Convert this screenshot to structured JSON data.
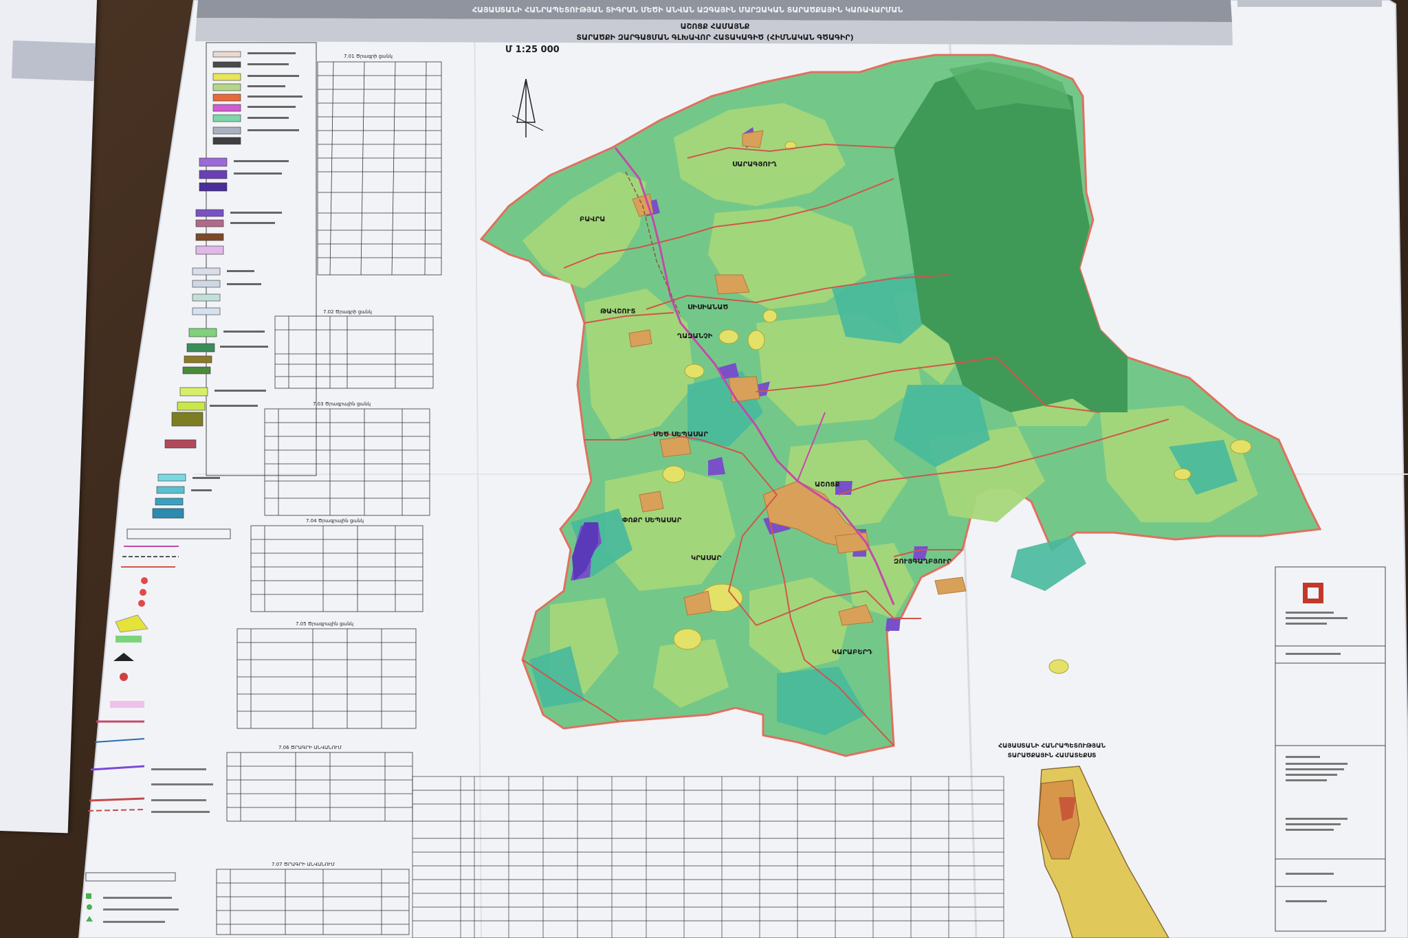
{
  "document": {
    "header_top": "ՀԱՅԱՍՏԱՆԻ ՀԱՆՐԱՊԵՏՈՒԹՅԱՆ ՏԻԳՐԱՆ ՄԵԾԻ ԱՆՎԱՆ ԱԶԳԱՅԻՆ ՄԱՐԶԱԿԱՆ ՏԱՐԱԾՔԱՅԻՆ ԿԱՌԱՎԱՐՄԱՆ",
    "community_title": "ԱՇՈՑՔ ՀԱՄԱՅՆՔ",
    "plan_title": "ՏԱՐԱԾՔԻ ԶԱՐԳԱՑՄԱՆ ԳԼԽԱՎՈՐ ՀԱՏԱԿԱԳԻԾ (ՀԻՄՆԱԿԱՆ ԳԾԱԳԻՐ)",
    "scale": "Մ 1:25 000",
    "inset_title_1": "ՀԱՅԱՍՏԱՆԻ ՀԱՆՐԱՊԵՏՈՒԹՅԱՆ",
    "inset_title_2": "ՏԱՐԱԾՔԱՅԻՆ ՀԱՄԱՏԵՔՍՏ"
  },
  "map": {
    "settlements": [
      {
        "id": "marmashen",
        "name": "ՍԱՐԱԳՅՈՒՂ"
      },
      {
        "id": "bavra",
        "name": "ԲԱՎՐԱ"
      },
      {
        "id": "tavshut",
        "name": "ԹԱՎՇՈՒՏ"
      },
      {
        "id": "shirakavan",
        "name": "ՍԻՍԻԱՆԱԾ"
      },
      {
        "id": "ghazanchi",
        "name": "ՂԱԶԱՆՉԻ"
      },
      {
        "id": "mets-sepasar",
        "name": "ՄԵԾ ՍԵՊԱՍԱՐ"
      },
      {
        "id": "poqr-sepasar",
        "name": "ՓՈՔՐ ՍԵՊԱՍԱՐ"
      },
      {
        "id": "ashotsk",
        "name": "ԱՇՈՑՔ"
      },
      {
        "id": "krasar",
        "name": "ԿՐԱՍԱՐ"
      },
      {
        "id": "zuygaghbyur",
        "name": "ԶՈՒՅԳԱՂԲՅՈՒՐ"
      },
      {
        "id": "karaberd",
        "name": "ԿԱՐԱԲԵՐԴ"
      }
    ],
    "colors": {
      "agri_light": "#9fd47a",
      "pasture": "#6cc78a",
      "forest": "#3f9a54",
      "teal": "#43b79b",
      "border": "#d2554a",
      "road": "#c44aa7",
      "settlement": "#d9a05a",
      "industrial": "#7a55c9",
      "yellow": "#e6e26a"
    }
  },
  "tables": {
    "t1_caption": "7.01 Ծրագրի ցանկ",
    "t2_caption": "7.02 Ծրագրի ցանկ",
    "t3_caption": "7.03 Ծրագրային ցանկ",
    "t4_caption": "7.04 Ծրագրային ցանկ",
    "t5_caption": "7.05 Ծրագրային ցանկ",
    "t6_caption": "7.06 ԾՐԱԳՐԻ ԱՆՎԱՆՈՒՄ",
    "t7_caption": "7.07 ԾՐԱԳՐԻ ԱՆՎԱՆՈՒՄ"
  }
}
